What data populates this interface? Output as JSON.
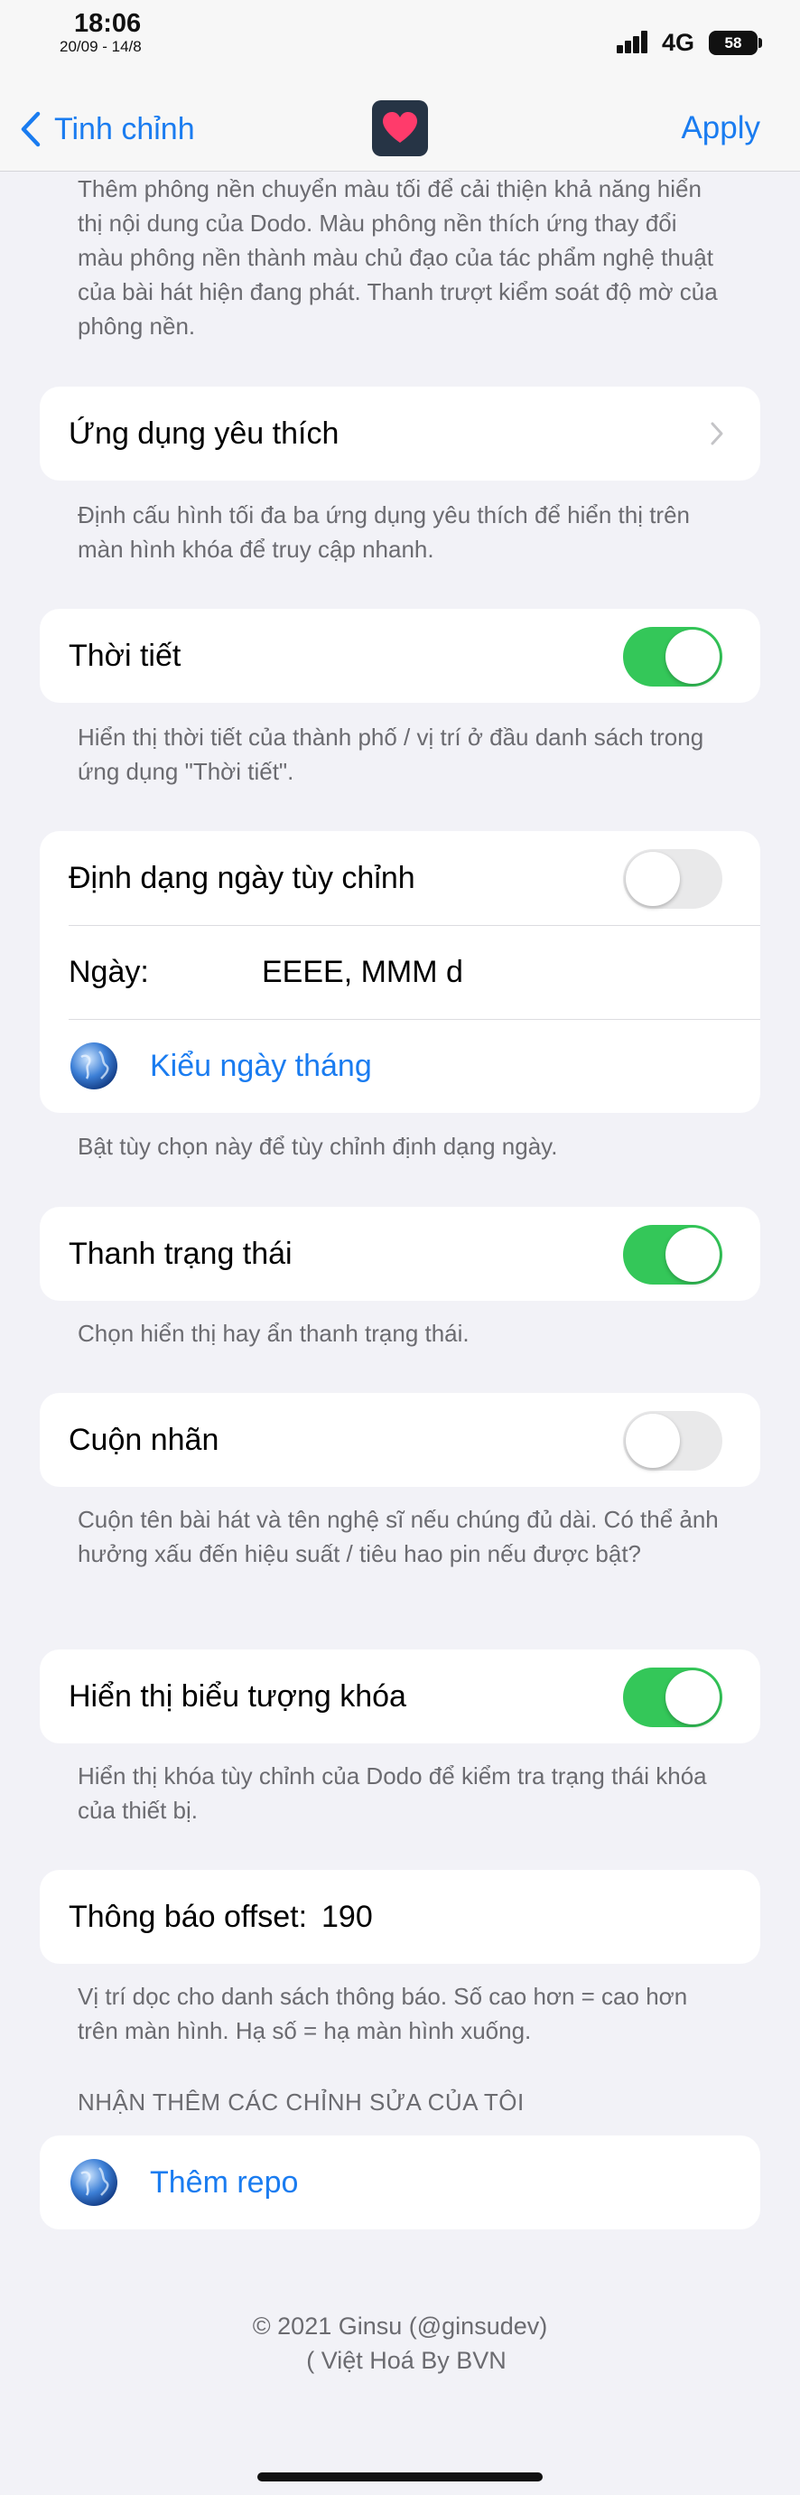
{
  "status_bar": {
    "time": "18:06",
    "date": "20/09 - 14/8",
    "network": "4G",
    "battery": "58"
  },
  "navbar": {
    "back_label": "Tinh chỉnh",
    "apply_label": "Apply",
    "accent_color": "#1a7cf0",
    "app_icon": "heart-icon"
  },
  "sections": {
    "background_desc": "Thêm phông nền chuyển màu tối để cải thiện khả năng hiển thị nội dung của Dodo. Màu phông nền thích ứng thay đổi màu phông nền thành màu chủ đạo của tác phẩm nghệ thuật của bài hát hiện đang phát. Thanh trượt kiểm soát độ mờ của phông nền.",
    "favorite_apps": {
      "label": "Ứng dụng yêu thích",
      "desc": "Định cấu hình tối đa ba ứng dụng yêu thích để hiển thị trên màn hình khóa để truy cập nhanh."
    },
    "weather": {
      "label": "Thời tiết",
      "enabled": true,
      "desc": "Hiển thị thời tiết của thành phố / vị trí ở đầu danh sách trong ứng dụng \"Thời tiết\"."
    },
    "custom_date": {
      "label": "Định dạng ngày tùy chỉnh",
      "enabled": false,
      "date_label": "Ngày:",
      "date_value": "EEEE, MMM d",
      "date_style_link": "Kiểu ngày tháng",
      "desc": "Bật tùy chọn này để tùy chỉnh định dạng ngày."
    },
    "status_bar_toggle": {
      "label": "Thanh trạng thái",
      "enabled": true,
      "desc": "Chọn hiển thị hay ẩn thanh trạng thái."
    },
    "marquee": {
      "label": "Cuộn nhãn",
      "enabled": false,
      "desc": "Cuộn tên bài hát và tên nghệ sĩ nếu chúng đủ dài. Có thể ảnh hưởng xấu đến hiệu suất / tiêu hao pin nếu được bật?"
    },
    "lock_icon": {
      "label": "Hiển thị biểu tượng khóa",
      "enabled": true,
      "desc": "Hiển thị khóa tùy chỉnh của Dodo để kiểm tra trạng thái khóa của thiết bị."
    },
    "notification_offset": {
      "label": "Thông báo offset:",
      "value": "190",
      "desc": "Vị trí dọc cho danh sách thông báo. Số cao hơn = cao hơn trên màn hình. Hạ số = hạ màn hình xuống."
    },
    "more_tweaks": {
      "header": "NHẬN THÊM CÁC CHỈNH SỬA CỦA TÔI",
      "add_repo_link": "Thêm repo"
    }
  },
  "footer": {
    "copyright": "© 2021 Ginsu (@ginsudev)",
    "credit": "( Việt Hoá By BVN"
  },
  "colors": {
    "toggle_on": "#34c759",
    "toggle_off": "#e9e9ea",
    "background": "#f2f2f7"
  }
}
